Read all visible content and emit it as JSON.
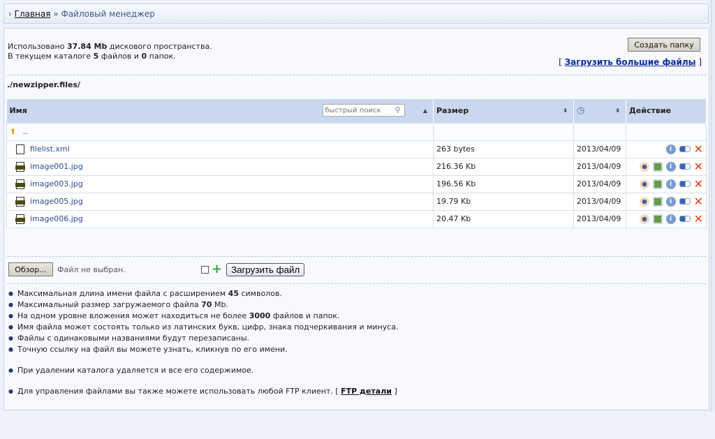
{
  "breadcrumb": {
    "home": "Главная",
    "sep": "»",
    "current": "Файловый менеджер"
  },
  "info": {
    "used_prefix": "Использовано",
    "used_value": "37.84 Mb",
    "used_suffix": "дискового пространства.",
    "dir_prefix": "В текущем каталоге",
    "files": "5",
    "files_word": "файлов и",
    "folders": "0",
    "folders_word": "папок."
  },
  "toolbar": {
    "create_folder": "Создать папку",
    "upload_big": "Загрузить большие файлы"
  },
  "path": "./newzipper.files/",
  "table": {
    "headers": {
      "name": "Имя",
      "size": "Размер",
      "action": "Действие"
    },
    "search_placeholder": "быстрый поиск",
    "up": "..",
    "rows": [
      {
        "name": "filelist.xml",
        "size": "263 bytes",
        "date": "2013/04/09",
        "type": "xml"
      },
      {
        "name": "image001.jpg",
        "size": "216.36 Kb",
        "date": "2013/04/09",
        "type": "jpg"
      },
      {
        "name": "image003.jpg",
        "size": "196.56 Kb",
        "date": "2013/04/09",
        "type": "jpg"
      },
      {
        "name": "image005.jpg",
        "size": "19.79 Kb",
        "date": "2013/04/09",
        "type": "jpg"
      },
      {
        "name": "image006.jpg",
        "size": "20.47 Kb",
        "date": "2013/04/09",
        "type": "jpg"
      }
    ]
  },
  "upload": {
    "browse": "Обзор...",
    "no_file": "Файл не выбран.",
    "submit": "Загрузить файл"
  },
  "notes": [
    {
      "pre": "Максимальная длина имени файла с расширением",
      "b": "45",
      "post": "символов."
    },
    {
      "pre": "Максимальный размер загружаемого файла",
      "b": "70",
      "post": "Mb."
    },
    {
      "pre": "На одном уровне вложения может находиться не более",
      "b": "3000",
      "post": "файлов и папок."
    },
    {
      "pre": "Имя файла может состоять только из латинских букв, цифр, знака подчеркивания и минуса."
    },
    {
      "pre": "Файлы с одинаковыми названиями будут перезаписаны."
    },
    {
      "pre": "Точную ссылку на файл вы можете узнать, кликнув по его имени."
    },
    {
      "pre": "При удалении каталога удаляется и все его содержимое."
    },
    {
      "pre": "Для управления файлами вы также можете использовать любой FTP клиент. [",
      "link": "FTP детали",
      "post": "]"
    }
  ]
}
